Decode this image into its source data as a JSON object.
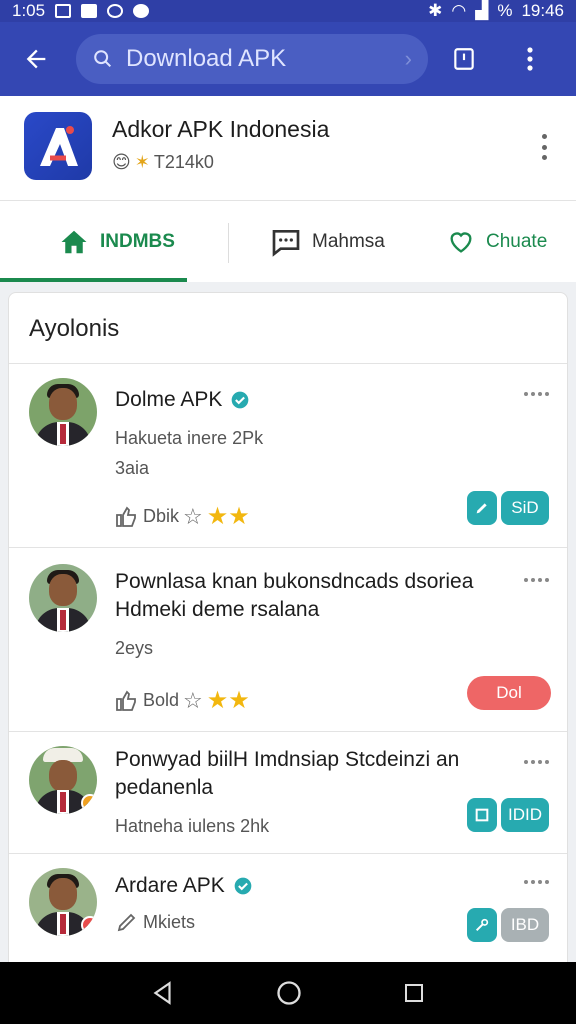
{
  "status_bar": {
    "time_left": "1:05",
    "time_right": "19:46",
    "battery": "%"
  },
  "search": {
    "placeholder": "Download APK"
  },
  "app": {
    "title": "Adkor APK Indonesia",
    "rating_text": "T214k0"
  },
  "tabs": [
    {
      "label": "INDMBS"
    },
    {
      "label": "Mahmsa"
    },
    {
      "label": "Chuate"
    }
  ],
  "section_title": "Ayolonis",
  "items": [
    {
      "name": "Dolme APK",
      "verified": true,
      "line1": "Hakueta inere 2Pk",
      "line2": "3aia",
      "action_label": "Dbik",
      "stars": "★★",
      "pill_label": "SiD"
    },
    {
      "text": "Pownlasa knan bukonsdncads dsoriea Hdmeki deme rsalana",
      "meta": "2eys",
      "action_label": "Bold",
      "stars": "★★",
      "pill_label": "Dol"
    },
    {
      "text": "Ponwyad biilH Imdnsiap Stcdeinzi an pedanenla",
      "meta": "Hatneha iulens 2hk",
      "pill_label": "IDID"
    },
    {
      "name": "Ardare APK",
      "verified": true,
      "action_label": "Mkiets",
      "pill_label": "IBD"
    }
  ],
  "colors": {
    "app_bar": "#3447b3",
    "accent_green": "#1b8a4e",
    "teal": "#27aab0",
    "coral": "#ee6666",
    "star": "#f2b70f",
    "verified": "#27aab0"
  },
  "icons": [
    "back-arrow-icon",
    "search-icon",
    "share-icon",
    "more-vert-icon",
    "home-icon",
    "chat-icon",
    "heart-icon",
    "verified-icon",
    "thumb-up-icon",
    "star-outline-icon"
  ]
}
